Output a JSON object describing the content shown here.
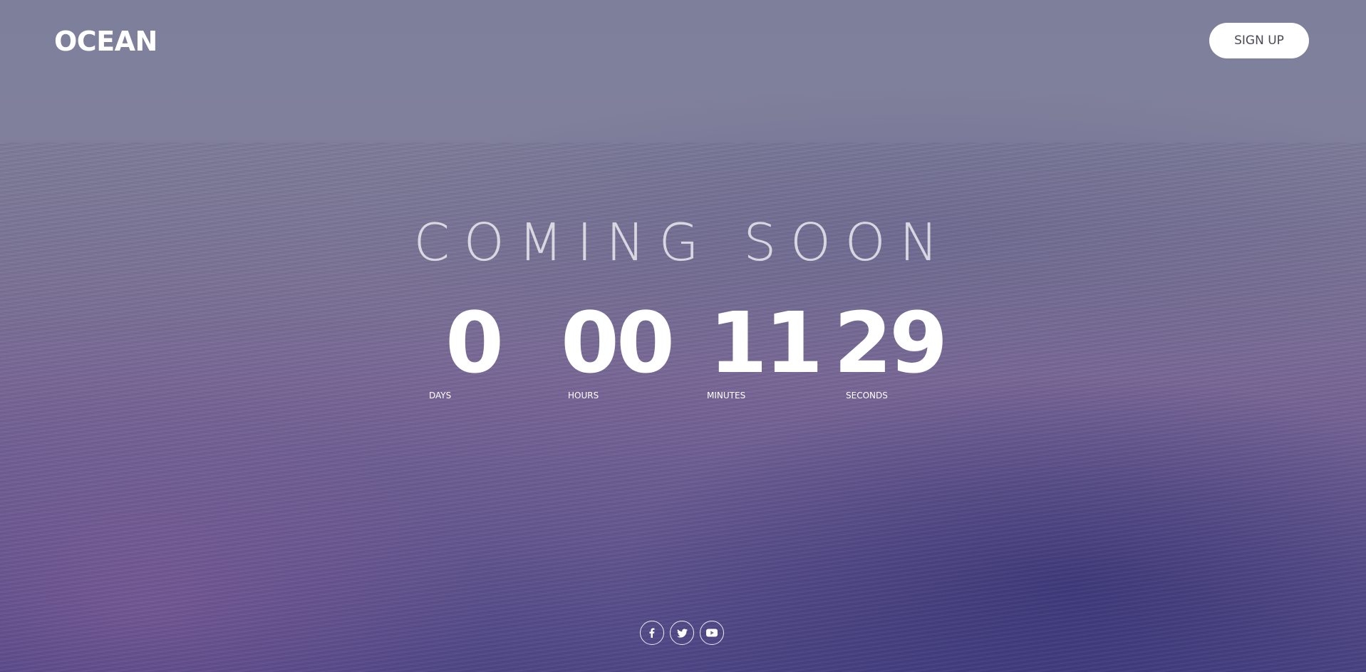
{
  "brand": {
    "logo_text": "OCEAN"
  },
  "header": {
    "signup_label": "SIGN UP"
  },
  "hero": {
    "headline": "COMING SOON"
  },
  "countdown": {
    "days": {
      "value": "0",
      "label": "DAYS"
    },
    "hours": {
      "value": "00",
      "label": "HOURS"
    },
    "minutes": {
      "value": "11",
      "label": "MINUTES"
    },
    "seconds": {
      "value": "29",
      "label": "SECONDS"
    }
  },
  "social": [
    {
      "icon": "facebook-icon"
    },
    {
      "icon": "twitter-icon"
    },
    {
      "icon": "youtube-icon"
    }
  ],
  "colors": {
    "accent": "#ffffff",
    "background_top": "#7d7f9b",
    "background_bottom": "#4f4888",
    "button_text": "#4a4a55"
  }
}
